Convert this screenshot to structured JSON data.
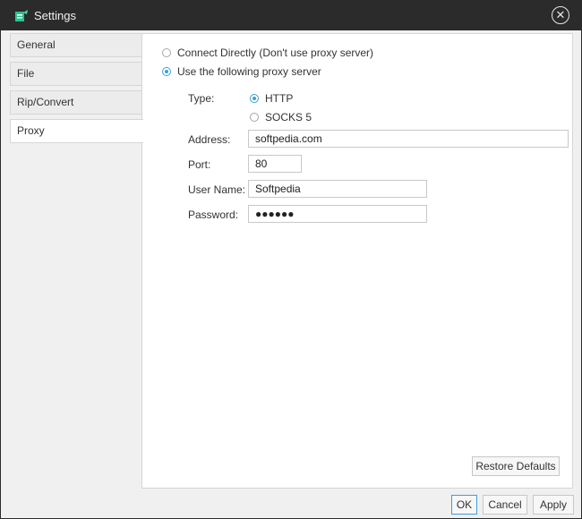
{
  "window": {
    "title": "Settings",
    "close_glyph": "✕"
  },
  "sidebar": {
    "items": [
      {
        "label": "General",
        "active": false
      },
      {
        "label": "File",
        "active": false
      },
      {
        "label": "Rip/Convert",
        "active": false
      },
      {
        "label": "Proxy",
        "active": true
      }
    ]
  },
  "proxy": {
    "options": [
      {
        "label": "Connect Directly (Don't use proxy server)",
        "selected": false
      },
      {
        "label": "Use the following proxy server",
        "selected": true
      }
    ],
    "type_label": "Type:",
    "types": [
      {
        "label": "HTTP",
        "selected": true
      },
      {
        "label": "SOCKS 5",
        "selected": false
      }
    ],
    "address_label": "Address:",
    "address_value": "softpedia.com",
    "port_label": "Port:",
    "port_value": "80",
    "username_label": "User Name:",
    "username_value": "Softpedia",
    "password_label": "Password:",
    "password_value": "●●●●●●"
  },
  "buttons": {
    "restore_defaults": "Restore Defaults",
    "ok": "OK",
    "cancel": "Cancel",
    "apply": "Apply"
  },
  "colors": {
    "accent": "#3c9fd8",
    "titlebar": "#2b2b2b"
  }
}
